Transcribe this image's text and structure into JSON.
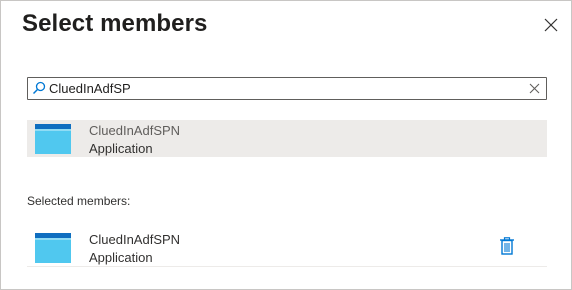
{
  "dialog": {
    "title": "Select members"
  },
  "search": {
    "value": "CluedInAdfSP"
  },
  "results": [
    {
      "name": "CluedInAdfSPN",
      "type": "Application"
    }
  ],
  "selected": {
    "label": "Selected members:",
    "items": [
      {
        "name": "CluedInAdfSPN",
        "type": "Application"
      }
    ]
  },
  "icons": {
    "close": "close-icon",
    "search": "search-icon",
    "clear": "clear-icon",
    "application": "application-icon",
    "delete": "trash-icon"
  },
  "colors": {
    "accent": "#0078d4",
    "selected_row_bg": "#edebe9",
    "app_icon_top": "#0f6ec0",
    "app_icon_body": "#50c8ef"
  }
}
